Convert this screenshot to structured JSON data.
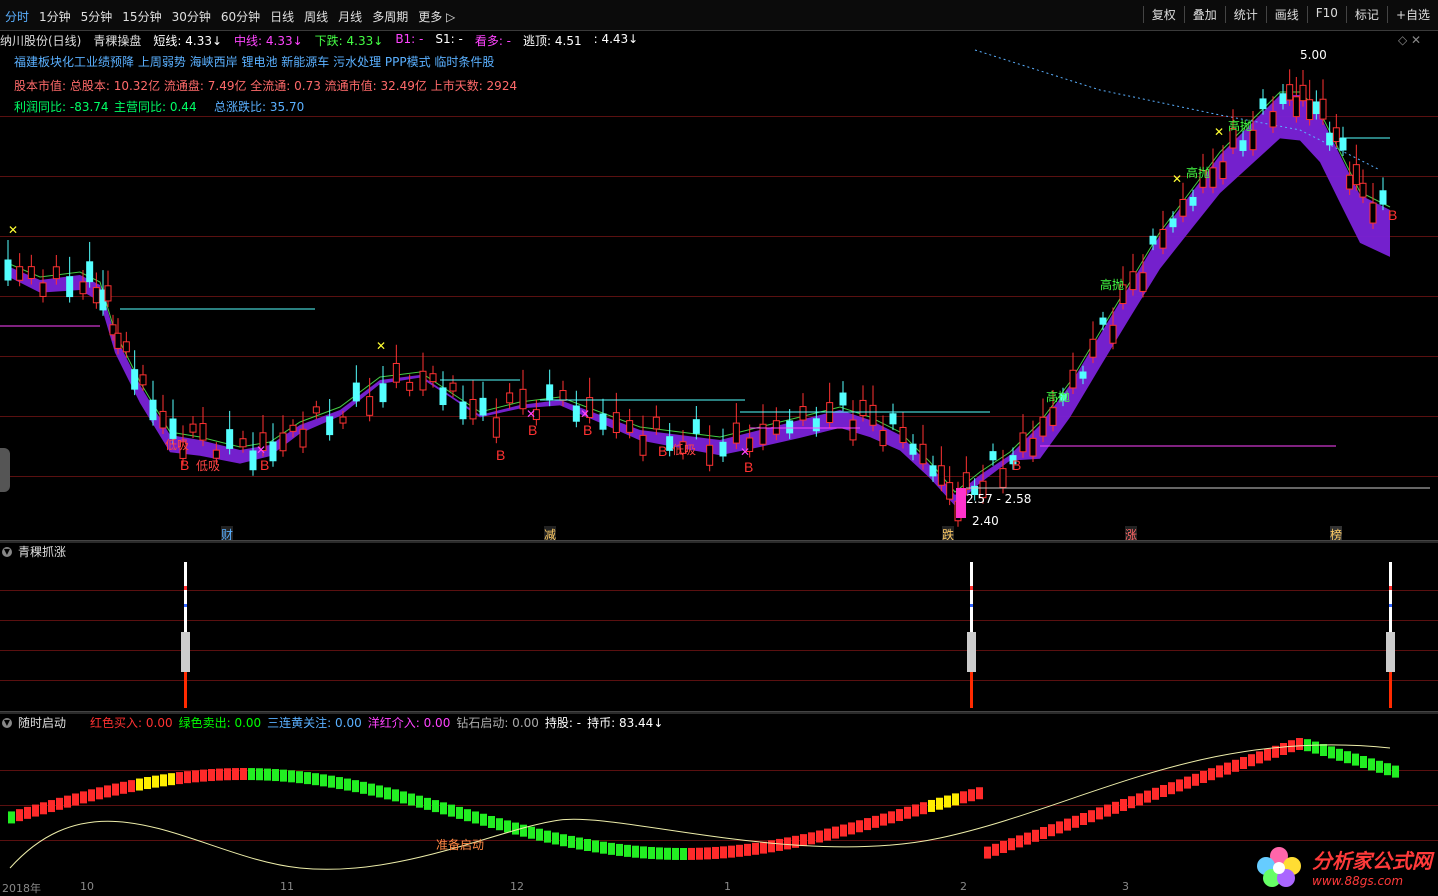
{
  "toolbar": {
    "tabs": [
      "分时",
      "1分钟",
      "5分钟",
      "15分钟",
      "30分钟",
      "60分钟",
      "日线",
      "周线",
      "月线",
      "多周期",
      "更多 ▷"
    ],
    "active_tab": 0,
    "right_tools": [
      "复权",
      "叠加",
      "统计",
      "画线",
      "F10",
      "标记",
      "+自选"
    ]
  },
  "info": {
    "stock": "纳川股份(日线)",
    "indicator": "青稞操盘",
    "short_line": "短线: 4.33↓",
    "mid_line": "中线: 4.33↓",
    "down": "下跌: 4.33↓",
    "b1": "B1: -",
    "s1": "S1: -",
    "look_more": "看多: -",
    "escape_top": "逃顶: 4.51",
    "last": ": 4.43↓"
  },
  "concepts": "福建板块化工业绩预降 上周弱势 海峡西岸 锂电池 新能源车 污水处理 PPP模式 临时条件股",
  "fundamentals": "股本市值: 总股本: 10.32亿 流通盘: 7.49亿 全流通: 0.73 流通市值: 32.49亿 上市天数: 2924",
  "profit": "利润同比: -83.74",
  "revenue": "主营同比: 0.44",
  "ratio": "总涨跌比: 35.70",
  "annotations": {
    "low_buy": "低吸",
    "high_sell": "高抛",
    "buy": "B",
    "price_range": "2.57 - 2.58",
    "low_price": "2.40",
    "high_price": "5.00",
    "cai": "财",
    "jian": "减",
    "die": "跌",
    "zhang": "涨",
    "bang": "榜",
    "zhunbei": "准备启动"
  },
  "panel2": {
    "title": "青稞抓涨"
  },
  "panel3": {
    "title": "随时启动",
    "red_buy": "红色买入: 0.00",
    "green_sell": "绿色卖出: 0.00",
    "three_yellow": "三连黄关注: 0.00",
    "foreign_red": "洋红介入: 0.00",
    "diamond": "钻石启动: 0.00",
    "hold": "持股: -",
    "coin": "持币: 83.44↓"
  },
  "xaxis": {
    "labels": [
      "2018年",
      "10",
      "11",
      "12",
      "1",
      "2",
      "3"
    ]
  },
  "logo": {
    "name": "分析家公式网",
    "url": "www.88gs.com"
  },
  "colors": {
    "up": "#ff3232",
    "down": "#54ffff",
    "purple": "#8a2be2",
    "yellow": "#ffff00",
    "green": "#00ff00"
  }
}
